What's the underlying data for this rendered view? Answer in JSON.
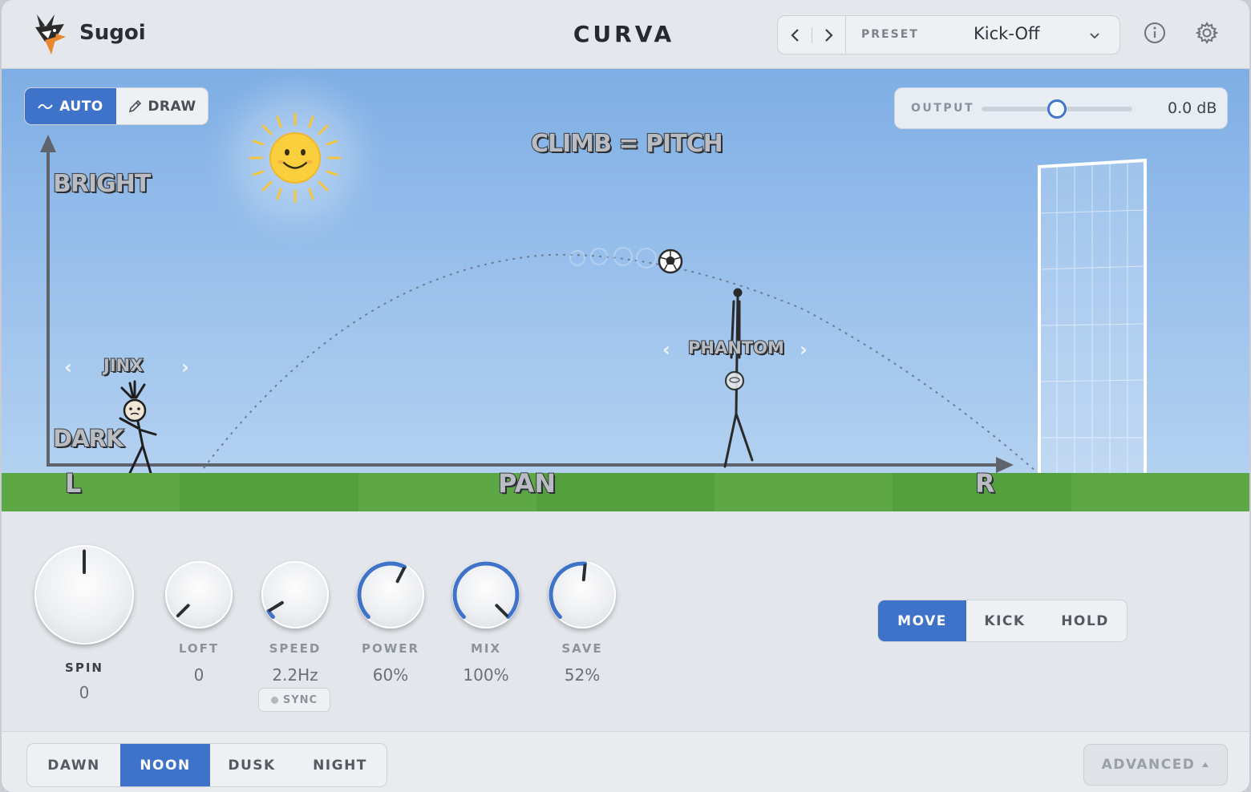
{
  "header": {
    "brand": "Sugoi",
    "title": "CURVA",
    "preset_label": "PRESET",
    "preset_value": "Kick-Off",
    "icons": [
      "fox-logo-icon",
      "chevron-left-icon",
      "chevron-right-icon",
      "chevron-down-icon",
      "info-icon",
      "gear-icon"
    ]
  },
  "scene": {
    "mode_toggle": [
      {
        "label": "AUTO",
        "icon": "wave-icon",
        "active": true
      },
      {
        "label": "DRAW",
        "icon": "pencil-icon",
        "active": false
      }
    ],
    "output": {
      "label": "OUTPUT",
      "value": "0.0 dB",
      "level": 0.5
    },
    "labels": {
      "climb": "CLIMB = PITCH",
      "bright": "BRIGHT",
      "dark": "DARK",
      "left": "L",
      "pan": "PAN",
      "right": "R"
    },
    "characters": {
      "left": "JINX",
      "right": "PHANTOM"
    },
    "colors": {
      "sky_top": "#7eaee4",
      "grass": "#5da844",
      "accent": "#3f73c9",
      "sun": "#f6c53b"
    }
  },
  "knobs": [
    {
      "name": "SPIN",
      "value": "0",
      "level": 0.5
    },
    {
      "name": "LOFT",
      "value": "0",
      "level": 0.0
    },
    {
      "name": "SPEED",
      "value": "2.2Hz",
      "level": 0.05
    },
    {
      "name": "POWER",
      "value": "60%",
      "level": 0.6
    },
    {
      "name": "MIX",
      "value": "100%",
      "level": 1.0
    },
    {
      "name": "SAVE",
      "value": "52%",
      "level": 0.52
    }
  ],
  "sync_label": "SYNC",
  "actions": [
    {
      "label": "MOVE",
      "active": true
    },
    {
      "label": "KICK",
      "active": false
    },
    {
      "label": "HOLD",
      "active": false
    }
  ],
  "footer": {
    "times": [
      {
        "label": "DAWN",
        "active": false
      },
      {
        "label": "NOON",
        "active": true
      },
      {
        "label": "DUSK",
        "active": false
      },
      {
        "label": "NIGHT",
        "active": false
      }
    ],
    "advanced_label": "ADVANCED",
    "advanced_icon": "caret-up-icon"
  }
}
